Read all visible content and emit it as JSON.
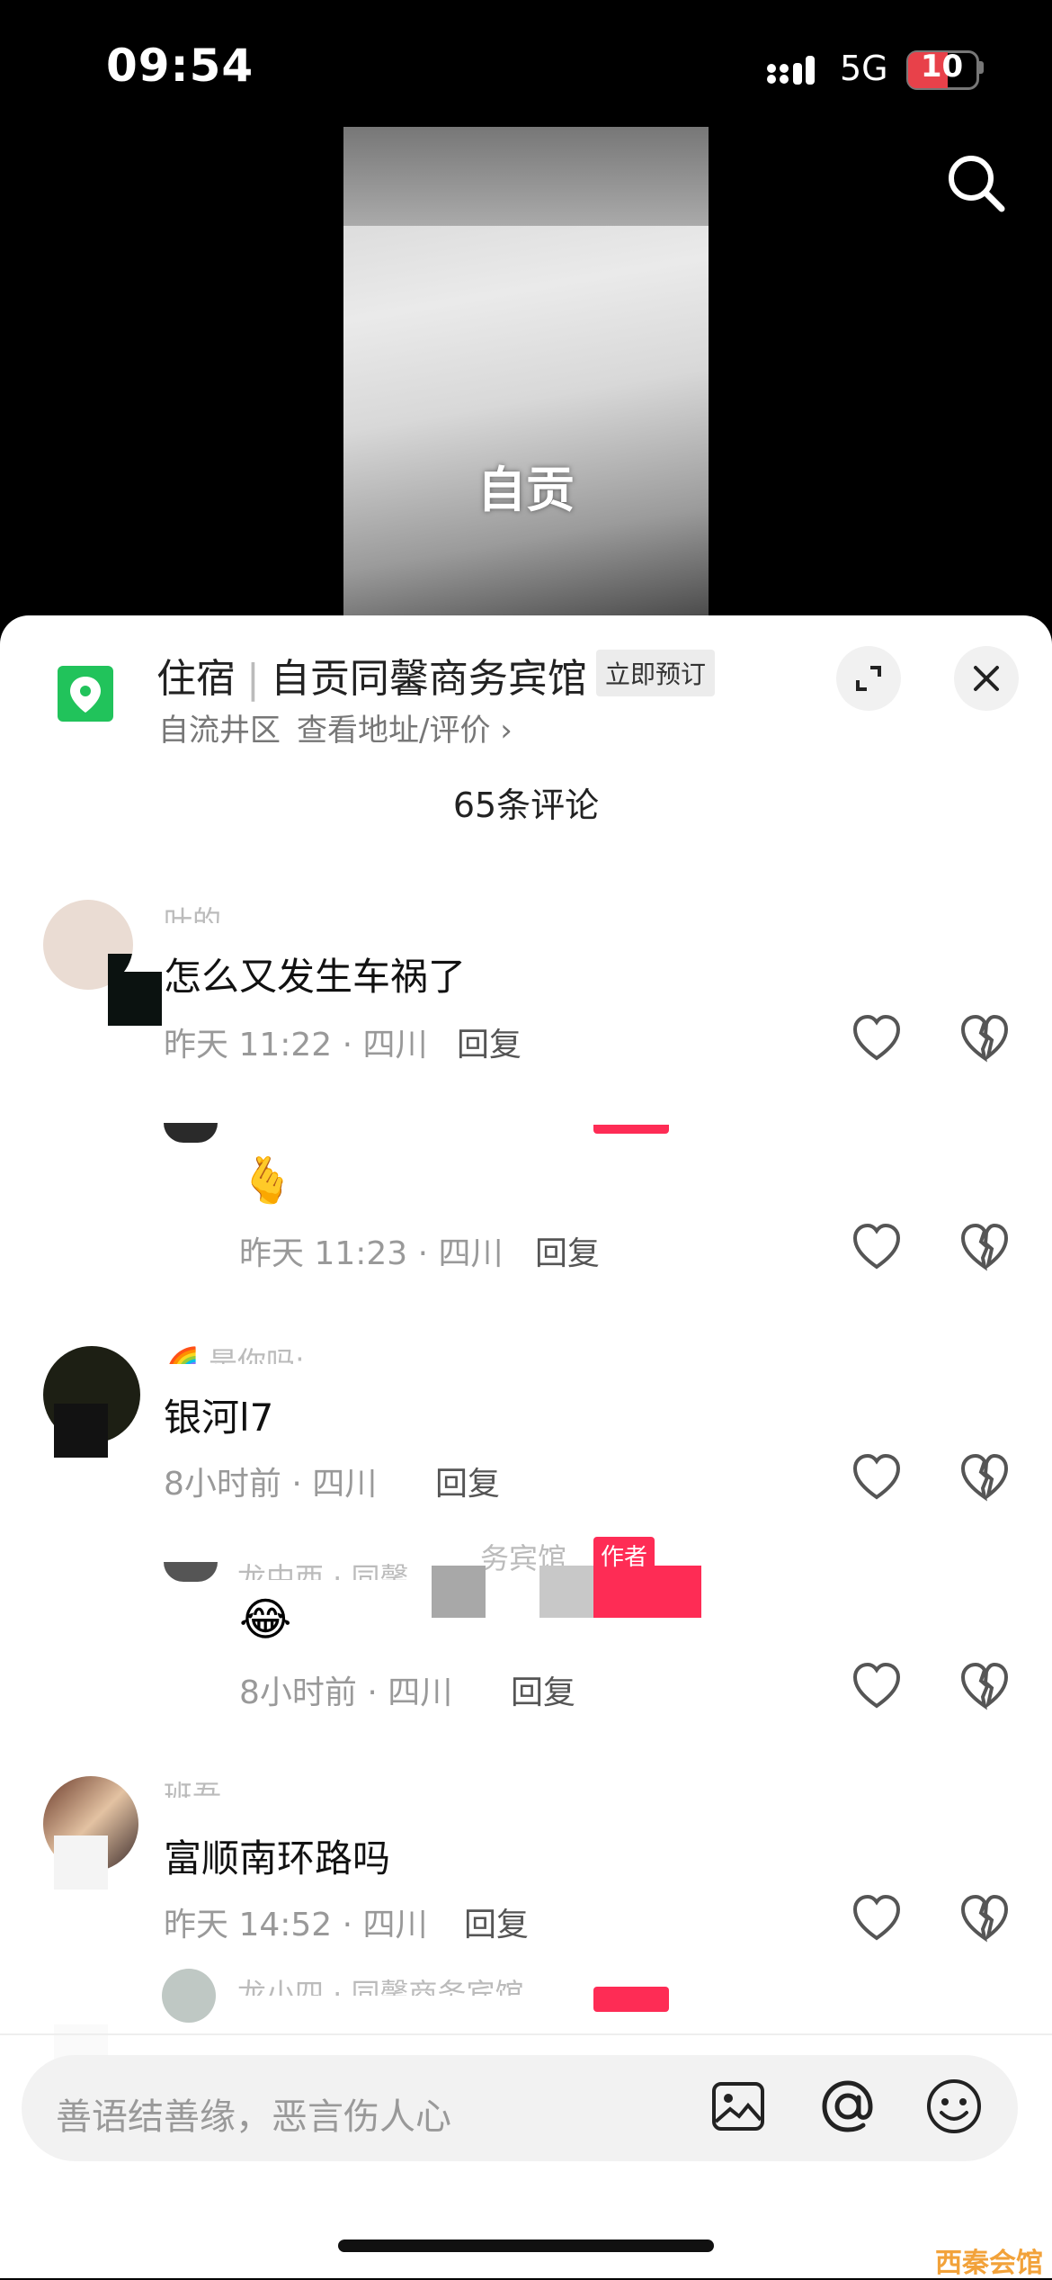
{
  "status_bar": {
    "time": "09:54",
    "network": "5G",
    "battery": "10"
  },
  "video": {
    "caption": "自贡"
  },
  "poi": {
    "category": "住宿",
    "name": "自贡同馨商务宾馆",
    "badge": "立即预订",
    "district": "自流井区",
    "link": "查看地址/评价 ›"
  },
  "comments_header": {
    "count_label": "65条评论"
  },
  "comments": [
    {
      "text": "怎么又发生车祸了",
      "meta": "昨天 11:22 · 四川",
      "reply_label": "回复",
      "reply": {
        "emoji": "🫰",
        "meta": "昨天 11:23 · 四川",
        "reply_label": "回复"
      }
    },
    {
      "text": "银河l7",
      "meta": "8小时前 · 四川",
      "reply_label": "回复",
      "reply": {
        "author_tag": "作者",
        "emoji": "😂",
        "meta": "8小时前 · 四川",
        "reply_label": "回复"
      }
    },
    {
      "text": "富顺南环路吗",
      "meta": "昨天 14:52 · 四川",
      "reply_label": "回复"
    }
  ],
  "input": {
    "placeholder": "善语结善缘，恶言伤人心"
  },
  "watermark": "西秦会馆",
  "colors": {
    "accent": "#fe2c55",
    "poi_green": "#21c35b",
    "battery_red": "#e8414a"
  }
}
